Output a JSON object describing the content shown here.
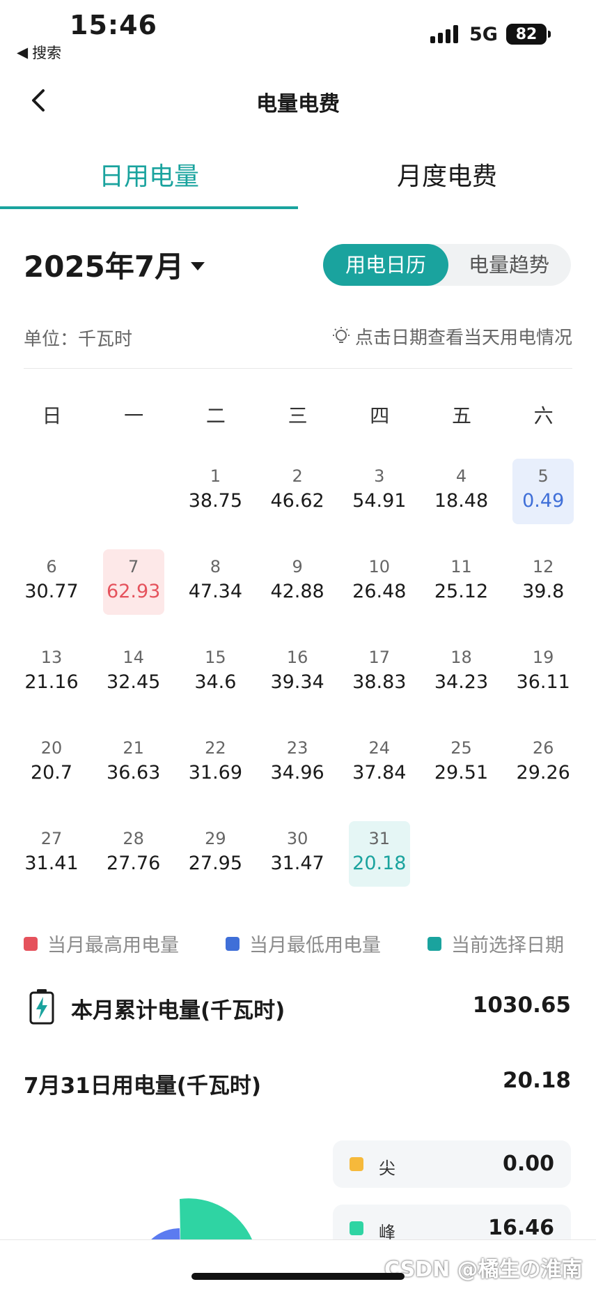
{
  "status": {
    "time": "15:46",
    "back_app": "搜索",
    "network": "5G",
    "battery": "82"
  },
  "nav": {
    "title": "电量电费"
  },
  "tabs": [
    {
      "label": "日用电量"
    },
    {
      "label": "月度电费"
    }
  ],
  "month": {
    "label": "2025年7月"
  },
  "view_toggle": {
    "calendar": "用电日历",
    "trend": "电量趋势"
  },
  "unit_label": "单位：千瓦时",
  "hint": "点击日期查看当天用电情况",
  "weekdays": [
    "日",
    "一",
    "二",
    "三",
    "四",
    "五",
    "六"
  ],
  "days": [
    {
      "d": "1",
      "v": "38.75"
    },
    {
      "d": "2",
      "v": "46.62"
    },
    {
      "d": "3",
      "v": "54.91"
    },
    {
      "d": "4",
      "v": "18.48"
    },
    {
      "d": "5",
      "v": "0.49"
    },
    {
      "d": "6",
      "v": "30.77"
    },
    {
      "d": "7",
      "v": "62.93"
    },
    {
      "d": "8",
      "v": "47.34"
    },
    {
      "d": "9",
      "v": "42.88"
    },
    {
      "d": "10",
      "v": "26.48"
    },
    {
      "d": "11",
      "v": "25.12"
    },
    {
      "d": "12",
      "v": "39.8"
    },
    {
      "d": "13",
      "v": "21.16"
    },
    {
      "d": "14",
      "v": "32.45"
    },
    {
      "d": "15",
      "v": "34.6"
    },
    {
      "d": "16",
      "v": "39.34"
    },
    {
      "d": "17",
      "v": "38.83"
    },
    {
      "d": "18",
      "v": "34.23"
    },
    {
      "d": "19",
      "v": "36.11"
    },
    {
      "d": "20",
      "v": "20.7"
    },
    {
      "d": "21",
      "v": "36.63"
    },
    {
      "d": "22",
      "v": "31.69"
    },
    {
      "d": "23",
      "v": "34.96"
    },
    {
      "d": "24",
      "v": "37.84"
    },
    {
      "d": "25",
      "v": "29.51"
    },
    {
      "d": "26",
      "v": "29.26"
    },
    {
      "d": "27",
      "v": "31.41"
    },
    {
      "d": "28",
      "v": "27.76"
    },
    {
      "d": "29",
      "v": "27.95"
    },
    {
      "d": "30",
      "v": "31.47"
    },
    {
      "d": "31",
      "v": "20.18"
    }
  ],
  "legend": [
    {
      "label": "当月最高用电量",
      "color": "#e5525c"
    },
    {
      "label": "当月最低用电量",
      "color": "#3f6fd8"
    },
    {
      "label": "当前选择日期",
      "color": "#1aa39e"
    }
  ],
  "summary": {
    "month_total_label": "本月累计电量(千瓦时)",
    "month_total_value": "1030.65",
    "day_label": "7月31日用电量(千瓦时)",
    "day_value": "20.18"
  },
  "tou": [
    {
      "name": "尖",
      "value": "0.00",
      "color": "#f6b93b"
    },
    {
      "name": "峰",
      "value": "16.46",
      "color": "#2fd4a3"
    }
  ],
  "watermark": "CSDN @橘生の淮南",
  "colors": {
    "accent": "#1aa39e",
    "max": "#e5525c",
    "min": "#3f6fd8"
  }
}
